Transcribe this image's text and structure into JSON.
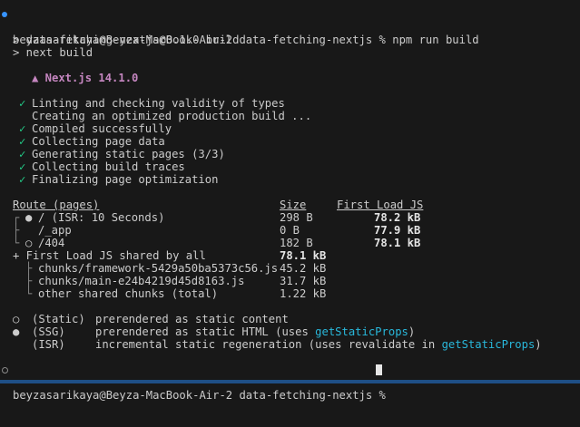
{
  "prompt": {
    "text": "beyzasarikaya@Beyza-MacBook-Air-2 data-fetching-nextjs % ",
    "command": "npm run build"
  },
  "script_lines": [
    "> data-fetching-nextjs@0.1.0 build",
    "> next build"
  ],
  "next_version": "▲ Next.js 14.1.0",
  "steps": [
    {
      "check": "✓",
      "text": "Linting and checking validity of types"
    },
    {
      "check": "",
      "text": "Creating an optimized production build ..."
    },
    {
      "check": "✓",
      "text": "Compiled successfully"
    },
    {
      "check": "✓",
      "text": "Collecting page data"
    },
    {
      "check": "✓",
      "text": "Generating static pages (3/3)"
    },
    {
      "check": "✓",
      "text": "Collecting build traces"
    },
    {
      "check": "✓",
      "text": "Finalizing page optimization"
    }
  ],
  "route_table": {
    "headers": {
      "route": "Route (pages)",
      "size": "Size",
      "first_load": "First Load JS"
    },
    "rows": [
      {
        "tree": "┌",
        "symbol": "●",
        "route": "/ (ISR: 10 Seconds)",
        "size": "298 B",
        "first_load": "78.2 kB"
      },
      {
        "tree": "├",
        "symbol": "",
        "route": "/_app",
        "size": "0 B",
        "first_load": "77.9 kB"
      },
      {
        "tree": "└",
        "symbol": "○",
        "route": "/404",
        "size": "182 B",
        "first_load": "78.1 kB"
      }
    ],
    "shared": {
      "label": "+ First Load JS shared by all",
      "value": "78.1 kB"
    },
    "chunks": [
      {
        "tree": "├",
        "name": "chunks/framework-5429a50ba5373c56.js",
        "size": "45.2 kB"
      },
      {
        "tree": "├",
        "name": "chunks/main-e24b4219d45d8163.js",
        "size": "31.7 kB"
      },
      {
        "tree": "└",
        "name": "other shared chunks (total)",
        "size": "1.22 kB"
      }
    ]
  },
  "legend": [
    {
      "symbol": "○",
      "kind": "(Static)",
      "desc": "prerendered as static content",
      "link": "",
      "tail": ""
    },
    {
      "symbol": "●",
      "kind": "(SSG)",
      "desc": "prerendered as static HTML (uses ",
      "link": "getStaticProps",
      "tail": ")"
    },
    {
      "symbol": "",
      "kind": "(ISR)",
      "desc": "incremental static regeneration (uses revalidate in ",
      "link": "getStaticProps",
      "tail": ")"
    }
  ],
  "final_prompt": "beyzasarikaya@Beyza-MacBook-Air-2 data-fetching-nextjs % ",
  "colors": {
    "background": "#181818",
    "success": "#23d18b",
    "link": "#29b8db",
    "status_bar": "#1f4f86"
  }
}
